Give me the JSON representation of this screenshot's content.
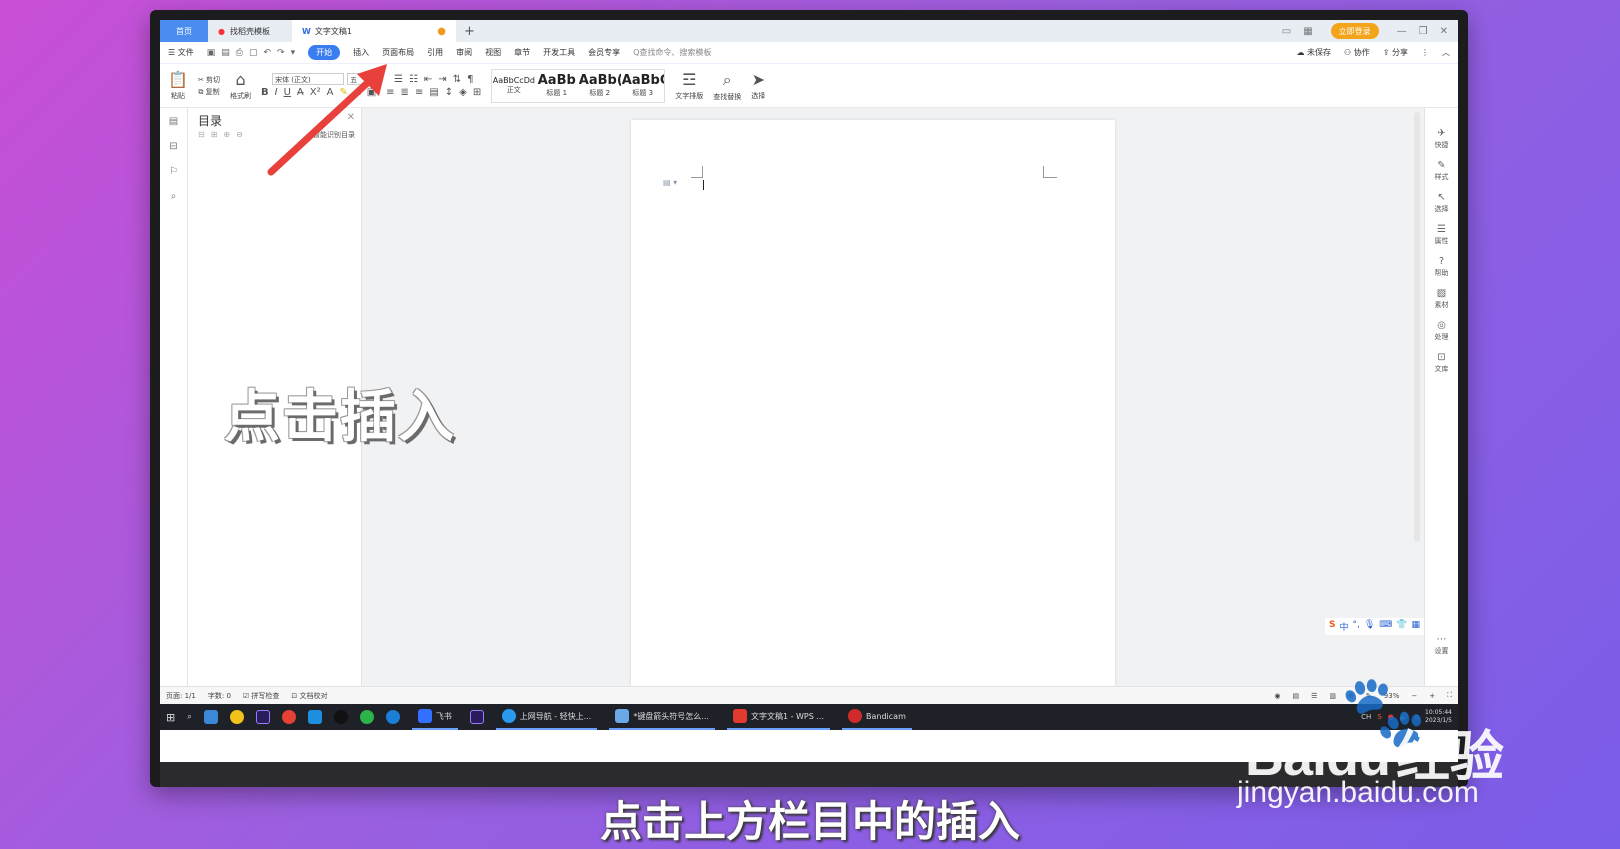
{
  "tabs": {
    "home": "首页",
    "template": "找稻壳模板",
    "document": "文字文稿1",
    "add": "+",
    "login": "立即登录"
  },
  "menu": {
    "file": "☰ 文件",
    "items": [
      "开始",
      "插入",
      "页面布局",
      "引用",
      "审阅",
      "视图",
      "章节",
      "开发工具",
      "会员专享"
    ],
    "search": "Q查找命令、搜索模板",
    "unsaved": "未保存",
    "collab": "协作",
    "share": "分享"
  },
  "ribbon": {
    "paste": "粘贴",
    "cut": "剪切",
    "copy": "复制",
    "format_painter": "格式刷",
    "font": "宋体 (正文)",
    "font_size": "五",
    "styles": [
      {
        "preview": "AaBbCcDd",
        "label": "正文"
      },
      {
        "preview": "AaBb",
        "label": "标题 1"
      },
      {
        "preview": "AaBb(",
        "label": "标题 2"
      },
      {
        "preview": "AaBbC",
        "label": "标题 3"
      }
    ],
    "text_layout": "文字排版",
    "find_replace": "查找替换",
    "select": "选择"
  },
  "toc": {
    "title": "目录",
    "smart": "智能识别目录"
  },
  "right_panel": [
    "快捷",
    "样式",
    "选择",
    "属性",
    "帮助",
    "素材",
    "处理",
    "文库",
    "设置"
  ],
  "status": {
    "page": "页面: 1/1",
    "words": "字数: 0",
    "spell": "拼写检查",
    "proof": "文档校对",
    "zoom": "93%"
  },
  "taskbar": {
    "apps": [
      {
        "label": "飞书"
      },
      {
        "label": "上网导航 - 轻快上..."
      },
      {
        "label": "*键盘箭头符号怎么..."
      },
      {
        "label": "文字文稿1 - WPS ..."
      },
      {
        "label": "Bandicam"
      }
    ],
    "lang": "CH",
    "time": "10:05:44",
    "date": "2023/1/5"
  },
  "ime": {
    "mode": "中"
  },
  "overlay": {
    "caption": "点击插入",
    "subtitle": "点击上方栏目中的插入"
  },
  "watermark": {
    "brand": "Bai",
    "brand2": "du",
    "jingyan": "经验",
    "url": "jingyan.baidu.com"
  },
  "colors": {
    "accent": "#3a7df0",
    "arrow": "#e8403a",
    "login": "#f3a41b"
  }
}
